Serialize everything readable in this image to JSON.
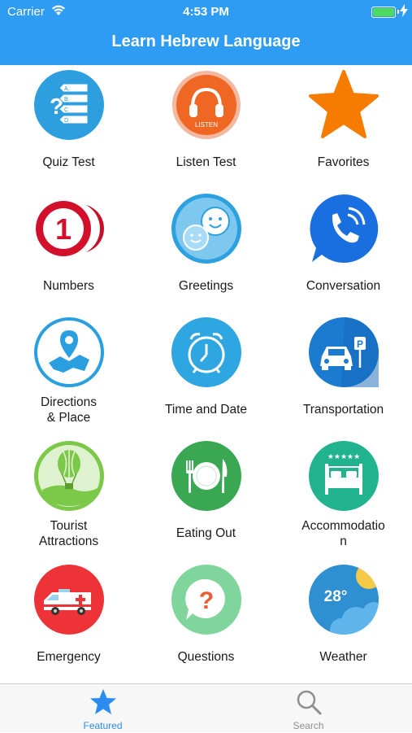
{
  "status_bar": {
    "carrier": "Carrier",
    "time": "4:53 PM"
  },
  "nav": {
    "title": "Learn Hebrew Language"
  },
  "tiles": [
    {
      "label": "Quiz Test",
      "icon": "quiz-icon"
    },
    {
      "label": "Listen Test",
      "icon": "headphones-icon",
      "badge": "LISTEN"
    },
    {
      "label": "Favorites",
      "icon": "star-icon"
    },
    {
      "label": "Numbers",
      "icon": "number-one-icon",
      "glyph": "1"
    },
    {
      "label": "Greetings",
      "icon": "smiley-chat-icon"
    },
    {
      "label": "Conversation",
      "icon": "phone-bubble-icon"
    },
    {
      "label": "Directions\n& Place",
      "line1": "Directions",
      "line2": "& Place",
      "icon": "map-pin-icon"
    },
    {
      "label": "Time and Date",
      "icon": "alarm-clock-icon"
    },
    {
      "label": "Transportation",
      "icon": "car-parking-icon",
      "glyph": "P"
    },
    {
      "label": "Tourist Attractions",
      "line1": "Tourist",
      "line2": "Attractions",
      "icon": "hot-air-balloon-icon"
    },
    {
      "label": "Eating Out",
      "icon": "plate-cutlery-icon"
    },
    {
      "label": "Accommodation",
      "line1": "Accommodatio",
      "line2": "n",
      "icon": "hotel-bed-icon",
      "glyph": "★★★★★"
    },
    {
      "label": "Emergency",
      "icon": "ambulance-icon"
    },
    {
      "label": "Questions",
      "icon": "question-bubble-icon",
      "glyph": "?"
    },
    {
      "label": "Weather",
      "icon": "weather-icon",
      "glyph": "28°"
    }
  ],
  "tabbar": {
    "items": [
      {
        "label": "Featured",
        "icon": "star-icon",
        "active": true
      },
      {
        "label": "Search",
        "icon": "search-icon",
        "active": false
      }
    ]
  },
  "colors": {
    "nav": "#2f9cf4",
    "active_tab": "#2a8cf0",
    "inactive_tab": "#8e8e93"
  }
}
